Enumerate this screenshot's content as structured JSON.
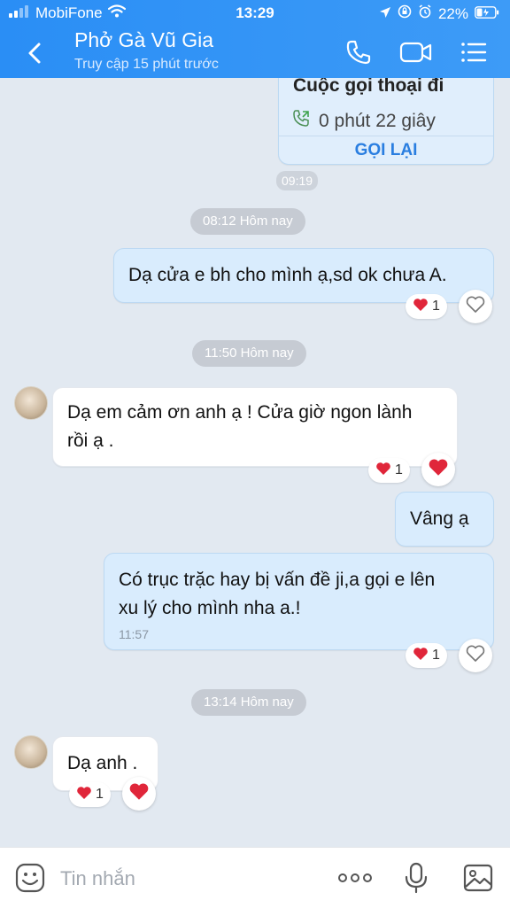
{
  "status": {
    "carrier": "MobiFone",
    "time": "13:29",
    "battery": "22%"
  },
  "header": {
    "title": "Phở Gà Vũ Gia",
    "subtitle": "Truy cập 15 phút trước",
    "icons": [
      "back-icon",
      "phone-icon",
      "video-icon",
      "menu-icon"
    ]
  },
  "call_card": {
    "title": "Cuộc gọi thoại đi",
    "duration": "0 phút 22 giây",
    "action": "GỌI LẠI",
    "time": "09:19"
  },
  "messages": [
    {
      "pill": "08:12 Hôm nay"
    },
    {
      "text": "Dạ cửa e bh cho mình ạ,sd ok chưa A.",
      "reaction_count": "1"
    },
    {
      "pill": "11:50 Hôm nay"
    },
    {
      "text_line1": "Dạ em cảm ơn anh ạ ! Cửa giờ ngon lành",
      "text_line2": "rồi ạ .",
      "reaction_count": "1"
    },
    {
      "text": "Vâng ạ"
    },
    {
      "text_line1": "Có trục trặc hay bị vấn đề ji,a gọi e lên",
      "text_line2": "xu lý cho mình nha a.!",
      "time": "11:57",
      "reaction_count": "1"
    },
    {
      "pill": "13:14 Hôm nay"
    },
    {
      "text": "Dạ anh .",
      "reaction_count": "1"
    }
  ],
  "composer": {
    "placeholder": "Tin nhắn",
    "icons": [
      "sticker-icon",
      "more-icon",
      "microphone-icon",
      "image-icon"
    ]
  },
  "colors": {
    "header": "#2a8ef5",
    "background": "#e2e9f1",
    "outgoing_bubble": "#d9ecfd",
    "incoming_bubble": "#ffffff",
    "heart": "#e0263a",
    "link": "#2a7ee0"
  }
}
